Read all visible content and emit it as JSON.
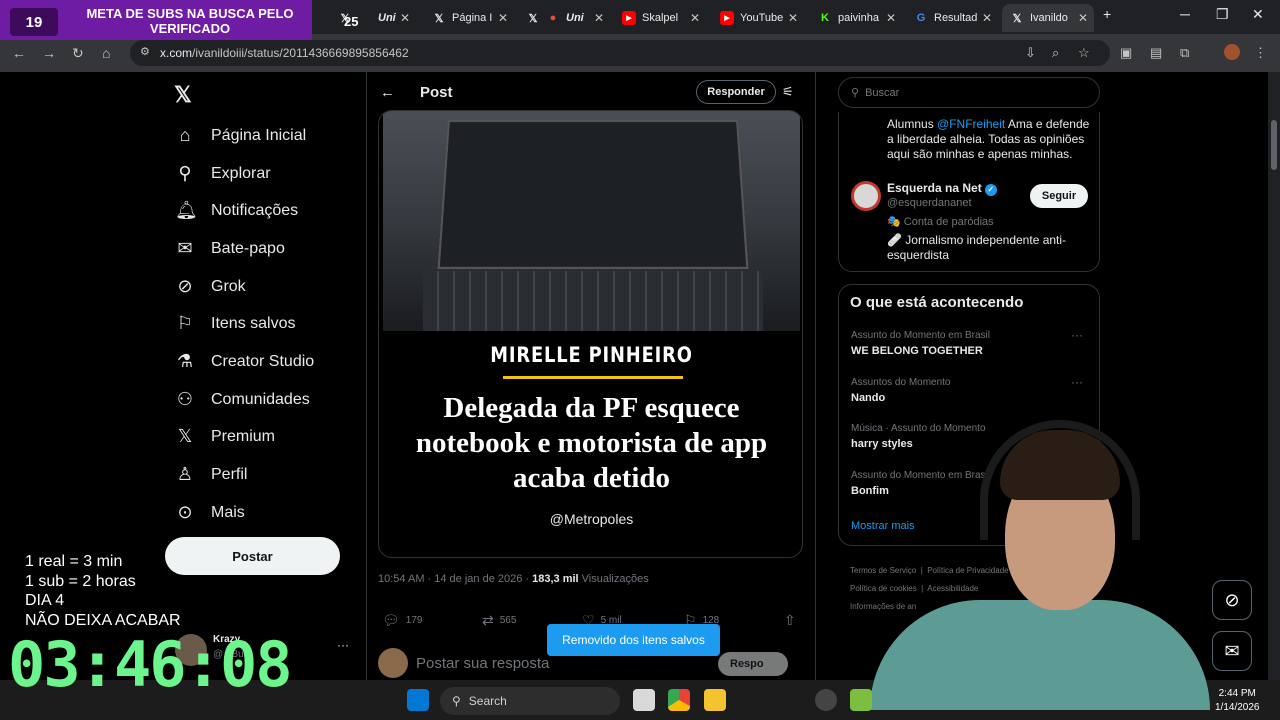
{
  "overlay": {
    "counter": "19",
    "banner": "META DE SUBS NA BUSCA PELO VERIFICADO",
    "tab_counter": "25",
    "lines": [
      "1 real = 3 min",
      "1 sub = 2 horas",
      "DIA 4",
      "NÃO DEIXA ACABAR"
    ],
    "timer": "03:46:08"
  },
  "browser": {
    "tabs": [
      {
        "label": "Uni",
        "icon": "x-icon"
      },
      {
        "label": "Página I",
        "icon": "x-icon"
      },
      {
        "label": "Uni",
        "icon": "record-icon"
      },
      {
        "label": "Skalpel",
        "icon": "youtube-icon"
      },
      {
        "label": "YouTube",
        "icon": "youtube-icon"
      },
      {
        "label": "paivinha",
        "icon": "kick-icon"
      },
      {
        "label": "Resultad",
        "icon": "google-icon"
      },
      {
        "label": "Ivanildo",
        "icon": "x-icon"
      }
    ],
    "url_host": "x.com",
    "url_path": "/ivanildoiii/status/2011436669895856462"
  },
  "nav": {
    "items": [
      {
        "label": "Página Inicial",
        "icon": "home-icon"
      },
      {
        "label": "Explorar",
        "icon": "search-icon"
      },
      {
        "label": "Notificações",
        "icon": "bell-icon"
      },
      {
        "label": "Bate-papo",
        "icon": "mail-icon"
      },
      {
        "label": "Grok",
        "icon": "grok-icon"
      },
      {
        "label": "Itens salvos",
        "icon": "bookmark-icon"
      },
      {
        "label": "Creator Studio",
        "icon": "flask-icon"
      },
      {
        "label": "Comunidades",
        "icon": "people-icon"
      },
      {
        "label": "Premium",
        "icon": "x-icon"
      },
      {
        "label": "Perfil",
        "icon": "user-icon"
      },
      {
        "label": "Mais",
        "icon": "more-icon"
      }
    ],
    "post_button": "Postar",
    "account_name": "Krazy",
    "account_handle": "@...Bug"
  },
  "post": {
    "header_title": "Post",
    "reply_header_button": "Responder",
    "image_brand": "MIRELLE PINHEIRO",
    "image_headline": "Delegada da PF esquece notebook e motorista de app acaba detido",
    "image_handle": "@Metropoles",
    "time": "10:54 AM · 14 de jan de 2026 · ",
    "views_count": "183,3 mil",
    "views_label": " Visualizações",
    "replies": "179",
    "reposts": "565",
    "likes": "5 mil",
    "bookmarks": "128",
    "reply_placeholder": "Postar sua resposta",
    "reply_button": "Respo",
    "toast": "Removido dos itens salvos"
  },
  "sidebar": {
    "search_placeholder": "Buscar",
    "bio_mention": "@FNFreiheit",
    "bio_text": "Alumnus @FNFreiheit Ama e defende a liberdade alheia. Todas as opiniões aqui são minhas e apenas minhas.",
    "bio_prefix": "Alumnus ",
    "bio_suffix": " Ama e defende a liberdade alheia. Todas as opiniões aqui são minhas e apenas minhas.",
    "account": {
      "name": "Esquerda na Net",
      "handle": "@esquerdananet",
      "label": "🎭 Conta de paródias",
      "desc": "🩹 Jornalismo independente anti-esquerdista",
      "follow": "Seguir"
    },
    "trends_title": "O que está acontecendo",
    "trends": [
      {
        "context": "Assunto do Momento em Brasil",
        "name": "WE BELONG TOGETHER"
      },
      {
        "context": "Assuntos do Momento",
        "name": "Nando"
      },
      {
        "context": "Música · Assunto do Momento",
        "name": "harry styles"
      },
      {
        "context": "Assunto do Momento em Brasil",
        "name": "Bonfim"
      }
    ],
    "show_more": "Mostrar mais",
    "footer": [
      "Termos de Serviço",
      "Política de Privacidade",
      "Política de cookies",
      "Acessibilidade",
      "Informações de an"
    ]
  },
  "taskbar": {
    "search": "Search",
    "time": "2:44 PM",
    "date": "1/14/2026"
  }
}
